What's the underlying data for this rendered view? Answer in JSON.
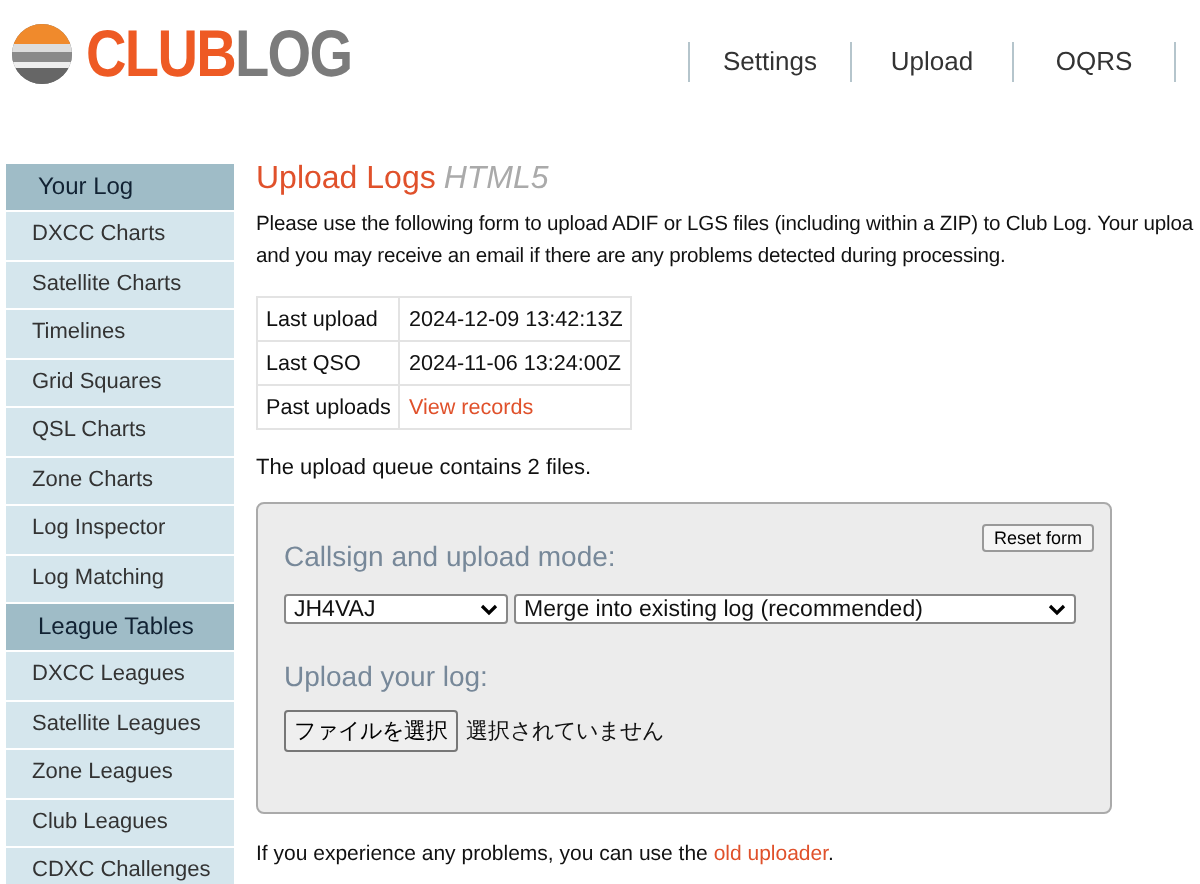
{
  "logo": {
    "part_1": "CLUB",
    "part_2": "LOG"
  },
  "nav": [
    {
      "label": "Settings"
    },
    {
      "label": "Upload"
    },
    {
      "label": "OQRS"
    }
  ],
  "sidebar": {
    "sections": [
      {
        "title": "Your Log",
        "items": [
          "DXCC Charts",
          "Satellite Charts",
          "Timelines",
          "Grid Squares",
          "QSL Charts",
          "Zone Charts",
          "Log Inspector",
          "Log Matching"
        ]
      },
      {
        "title": "League Tables",
        "items": [
          "DXCC Leagues",
          "Satellite Leagues",
          "Zone Leagues",
          "Club Leagues",
          "CDXC Challenges"
        ]
      }
    ]
  },
  "page": {
    "title": "Upload Logs",
    "title_tag": "HTML5",
    "intro_lines": [
      "Please use the following form to upload ADIF or LGS files (including within a ZIP) to Club Log. Your uploa",
      "and you may receive an email if there are any problems detected during processing."
    ],
    "info_table": [
      {
        "label": "Last upload",
        "value": "2024-12-09 13:42:13Z",
        "kind": "text"
      },
      {
        "label": "Last QSO",
        "value": "2024-11-06 13:24:00Z",
        "kind": "text"
      },
      {
        "label": "Past uploads",
        "value": "View records",
        "kind": "link"
      }
    ],
    "queue_text": "The upload queue contains 2 files.",
    "form": {
      "reset_button": "Reset form",
      "mode_heading": "Callsign and upload mode:",
      "callsign": "JH4VAJ",
      "mode": "Merge into existing log (recommended)",
      "upload_heading": "Upload your log:",
      "file_button": "ファイルを選択",
      "file_status": "選択されていません"
    },
    "footer_text": "If you experience any problems, you can use the",
    "footer_link": "old uploader",
    "footer_end": "."
  }
}
